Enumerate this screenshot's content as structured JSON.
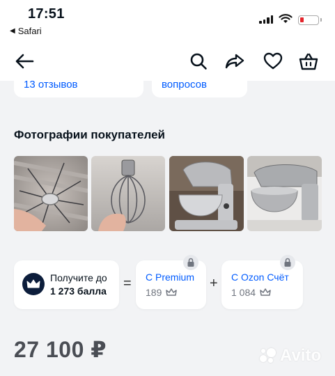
{
  "status_bar": {
    "time": "17:51",
    "back_app": "Safari"
  },
  "nav": {
    "icons": [
      "back-arrow-icon",
      "search-icon",
      "share-icon",
      "heart-icon",
      "basket-icon"
    ]
  },
  "top_cards": {
    "reviews_label": "13 отзывов",
    "questions_label": "вопросов"
  },
  "photos": {
    "title": "Фотографии покупателей",
    "items": [
      "photo-whisk-in-hand-1",
      "photo-whisk-in-hand-2",
      "photo-stand-mixer-1",
      "photo-stand-mixer-2"
    ]
  },
  "bonus": {
    "line1": "Получите до",
    "line2": "1 273 балла",
    "equals": "=",
    "plus": "+",
    "premium": {
      "title": "С Premium",
      "value": "189"
    },
    "ozon": {
      "title": "С Ozon Счёт",
      "value": "1 084"
    }
  },
  "price": "27 100 ₽",
  "watermark": "Avito",
  "colors": {
    "accent": "#005bff",
    "background": "#f2f3f5",
    "price": "#4a4d54",
    "crown_circle": "#0c1d3b"
  }
}
